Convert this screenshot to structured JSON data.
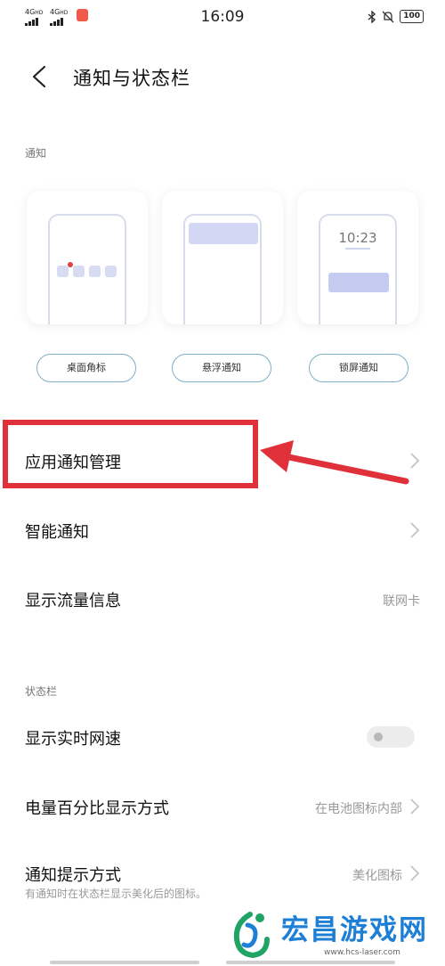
{
  "status_bar": {
    "sim1": "4G",
    "sim1_sup": "HD",
    "sim2": "4G",
    "sim2_sup": "HD",
    "time": "16:09",
    "battery": "100"
  },
  "header": {
    "title": "通知与状态栏"
  },
  "notification_section": {
    "label": "通知",
    "styles": [
      {
        "label": "桌面角标",
        "icon": "badge-preview"
      },
      {
        "label": "悬浮通知",
        "icon": "banner-preview"
      },
      {
        "label": "锁屏通知",
        "icon": "lockscreen-preview",
        "lock_time": "10:23"
      }
    ]
  },
  "rows": [
    {
      "title": "应用通知管理"
    },
    {
      "title": "智能通知"
    },
    {
      "title": "显示流量信息",
      "value": "联网卡"
    }
  ],
  "status_section": {
    "label": "状态栏",
    "rows": [
      {
        "title": "显示实时网速",
        "toggle_on": false
      },
      {
        "title": "电量百分比显示方式",
        "value": "在电池图标内部"
      },
      {
        "title": "通知提示方式",
        "value": "美化图标",
        "subtitle": "有通知时在状态栏显示美化后的图标。"
      }
    ]
  },
  "annotation": {
    "highlight_color": "#e0303a"
  },
  "watermark": {
    "text": "宏昌游戏网",
    "url": "www.hcs-laser.com"
  }
}
